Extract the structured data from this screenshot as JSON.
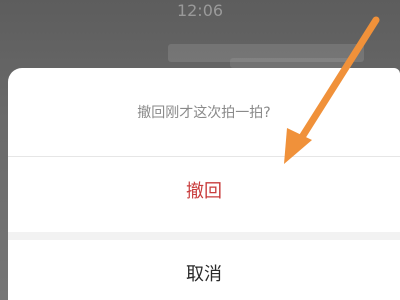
{
  "status_bar": {
    "time": "12:06"
  },
  "sheet": {
    "prompt": "撤回刚才这次拍一拍?",
    "recall_label": "撤回",
    "cancel_label": "取消"
  },
  "colors": {
    "recall": "#c83c3c",
    "arrow": "#f0913a",
    "overlay": "#6a6a6a"
  },
  "annotation": {
    "icon": "arrow-pointer-icon"
  }
}
